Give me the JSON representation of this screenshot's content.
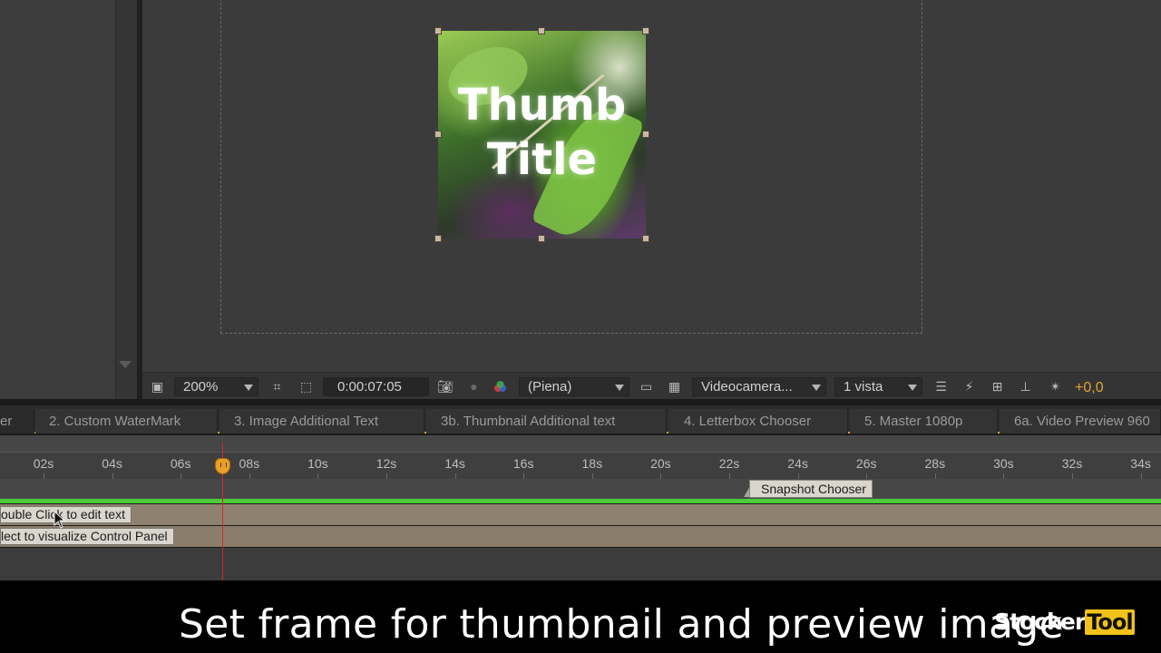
{
  "viewer": {
    "thumb_title": "Thumb Title",
    "toolbar": {
      "zoom": "200%",
      "timecode": "0:00:07:05",
      "resolution": "(Piena)",
      "camera": "Videocamera...",
      "views": "1 vista",
      "exposure": "+0,0"
    }
  },
  "tabs": [
    "er",
    "2. Custom WaterMark",
    "3. Image Additional Text",
    "3b. Thumbnail Additional text",
    "4. Letterbox Chooser",
    "5. Master 1080p",
    "6a. Video Preview 960"
  ],
  "timeline": {
    "ticks": [
      "02s",
      "04s",
      "06s",
      "08s",
      "10s",
      "12s",
      "14s",
      "16s",
      "18s",
      "20s",
      "22s",
      "24s",
      "26s",
      "28s",
      "30s",
      "32s",
      "34s"
    ],
    "marker": "Snapshot Chooser",
    "layers": [
      "ouble Click to edit text",
      "lect to visualize Control Panel"
    ]
  },
  "caption": "Set frame for thumbnail and preview image",
  "logo": {
    "part1": "Stocker",
    "part2": "Tool"
  },
  "colors": {
    "accent": "#e0a637",
    "playhead": "#e02222",
    "green_bar": "#4ecb3a",
    "layer": "#8e826f"
  }
}
